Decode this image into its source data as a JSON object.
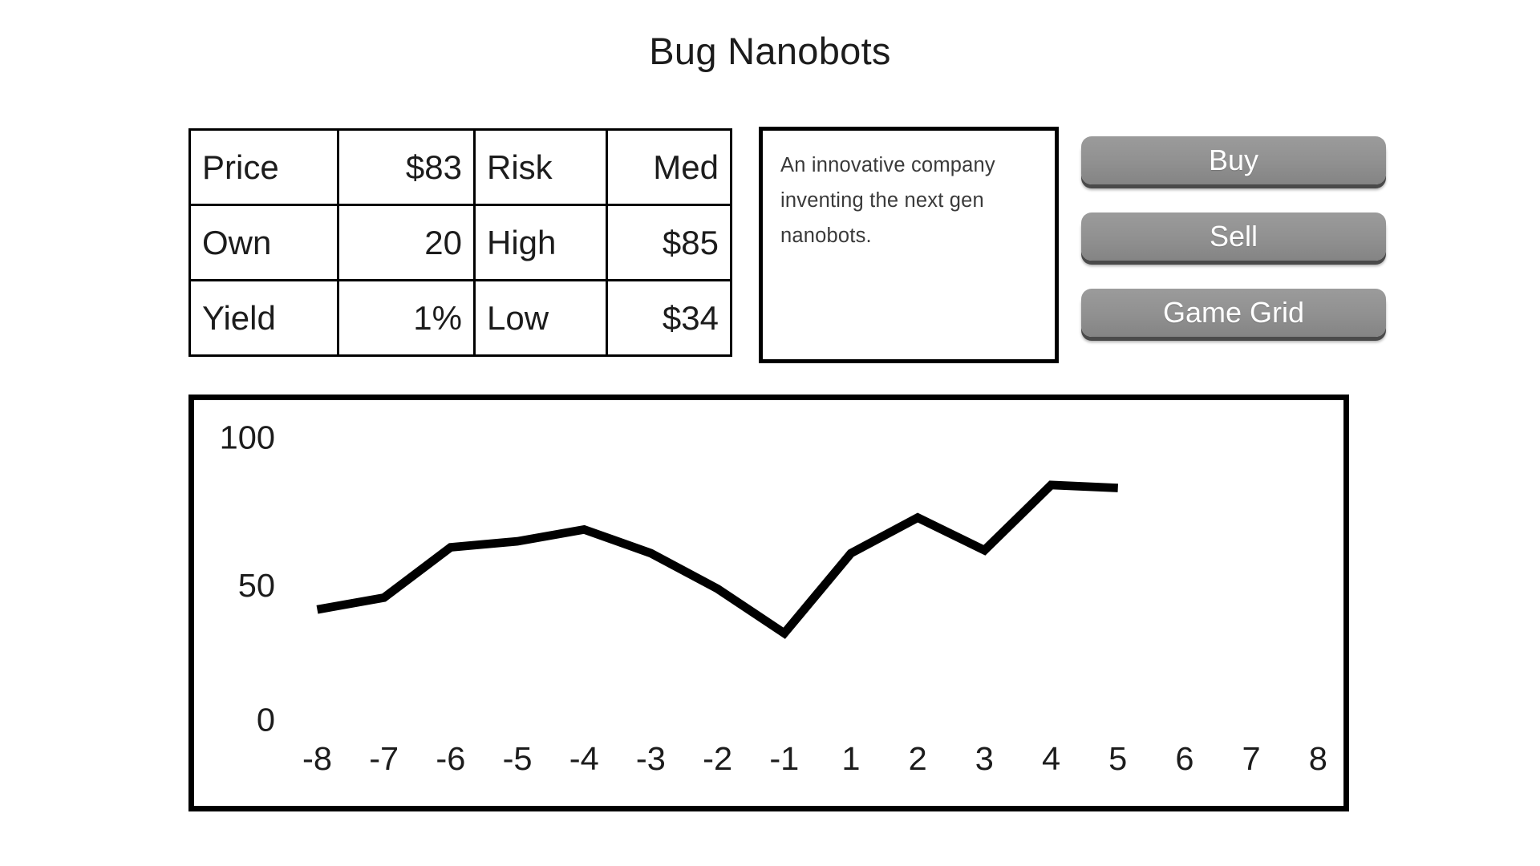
{
  "app": {
    "title": "Bug Nanobots"
  },
  "stats_table": {
    "rows": [
      [
        {
          "text": "Price",
          "align": "left"
        },
        {
          "text": "$83",
          "align": "right"
        },
        {
          "text": "Risk",
          "align": "left"
        },
        {
          "text": "Med",
          "align": "right"
        }
      ],
      [
        {
          "text": "Own",
          "align": "left"
        },
        {
          "text": "20",
          "align": "right"
        },
        {
          "text": "High",
          "align": "left"
        },
        {
          "text": "$85",
          "align": "right"
        }
      ],
      [
        {
          "text": "Yield",
          "align": "left"
        },
        {
          "text": "1%",
          "align": "right"
        },
        {
          "text": "Low",
          "align": "left"
        },
        {
          "text": "$34",
          "align": "right"
        }
      ]
    ]
  },
  "description": {
    "text": "An innovative company inventing the next gen nanobots."
  },
  "buttons": [
    {
      "label": "Buy",
      "name": "buy-button"
    },
    {
      "label": "Sell",
      "name": "sell-button"
    },
    {
      "label": "Game Grid",
      "name": "game-grid-button"
    }
  ],
  "colors": {
    "button_face": "#909090",
    "button_shadow": "#4a4a4a",
    "button_text": "#ffffff",
    "line": "#000000",
    "frame": "#000000",
    "text": "#1c1c1c",
    "description_text": "#3a3a3a",
    "background": "#ffffff"
  },
  "chart_data": {
    "type": "line",
    "title": "",
    "xlabel": "",
    "ylabel": "",
    "grid": false,
    "legend": "none",
    "x": [
      -8,
      -7,
      -6,
      -5,
      -4,
      -3,
      -2,
      -1,
      1,
      2,
      3,
      4,
      5
    ],
    "categories": [
      "-8",
      "-7",
      "-6",
      "-5",
      "-4",
      "-3",
      "-2",
      "-1",
      "1",
      "2",
      "3",
      "4",
      "5"
    ],
    "values": [
      42,
      46,
      63,
      65,
      69,
      61,
      49,
      34,
      61,
      73,
      62,
      84,
      83
    ],
    "xtick_labels": [
      "-8",
      "-7",
      "-6",
      "-5",
      "-4",
      "-3",
      "-2",
      "-1",
      "1",
      "2",
      "3",
      "4",
      "5",
      "6",
      "7",
      "8"
    ],
    "xtick_values": [
      -8,
      -7,
      -6,
      -5,
      -4,
      -3,
      -2,
      -1,
      1,
      2,
      3,
      4,
      5,
      6,
      7,
      8
    ],
    "ytick_labels": [
      "100",
      "50",
      "0"
    ],
    "ytick_values": [
      100,
      50,
      0
    ],
    "ylim": [
      0,
      100
    ],
    "xlim": [
      -8.5,
      8.5
    ]
  }
}
